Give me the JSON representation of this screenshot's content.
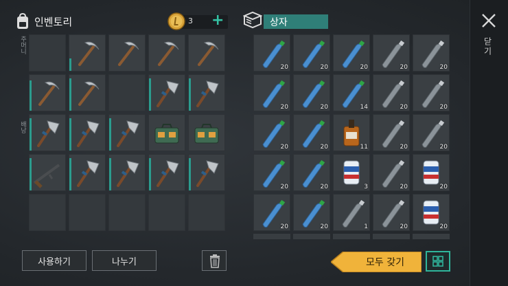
{
  "inventory": {
    "title": "인벤토리",
    "coins": "3",
    "pocket_label": "주머니",
    "bag_label": "배낭"
  },
  "box": {
    "title": "상자"
  },
  "close": {
    "label": "닫기"
  },
  "buttons": {
    "use": "사용하기",
    "split": "나누기",
    "take_all": "모두 갖기"
  },
  "colors": {
    "accent": "#2fb59b",
    "durability": "#2b9c8e",
    "take_all": "#f0b33a",
    "header_bar": "#2f7f78"
  },
  "inventory_slots": [
    {
      "item": "empty"
    },
    {
      "item": "pickaxe-icon",
      "durability": 0.35
    },
    {
      "item": "pickaxe-icon"
    },
    {
      "item": "pickaxe-icon"
    },
    {
      "item": "pickaxe-icon"
    },
    {
      "item": "pickaxe-icon",
      "durability": 0.85
    },
    {
      "item": "pickaxe-icon",
      "durability": 0.9
    },
    {
      "item": "empty"
    },
    {
      "item": "hatchet-icon",
      "durability": 0.9
    },
    {
      "item": "hatchet-icon",
      "durability": 0.9
    },
    {
      "item": "hatchet-icon",
      "durability": 0.9
    },
    {
      "item": "hatchet-icon",
      "durability": 0.9
    },
    {
      "item": "hatchet-icon",
      "durability": 0.9
    },
    {
      "item": "toolbox-icon"
    },
    {
      "item": "toolbox-icon"
    },
    {
      "item": "rifle-icon",
      "durability": 0.9
    },
    {
      "item": "hatchet-icon",
      "durability": 0.9
    },
    {
      "item": "hatchet-icon",
      "durability": 0.9
    },
    {
      "item": "hatchet-icon",
      "durability": 0.9
    },
    {
      "item": "hatchet-icon",
      "durability": 0.9
    },
    {
      "item": "empty"
    },
    {
      "item": "empty"
    },
    {
      "item": "empty"
    },
    {
      "item": "empty"
    },
    {
      "item": "empty"
    }
  ],
  "box_slots": [
    {
      "item": "water-bottle-icon",
      "qty": "20"
    },
    {
      "item": "water-bottle-icon",
      "qty": "20"
    },
    {
      "item": "water-bottle-icon",
      "qty": "20"
    },
    {
      "item": "empty-bottle-icon",
      "qty": "20"
    },
    {
      "item": "empty-bottle-icon",
      "qty": "20"
    },
    {
      "item": "water-bottle-icon",
      "qty": "20"
    },
    {
      "item": "water-bottle-icon",
      "qty": "20"
    },
    {
      "item": "water-bottle-icon",
      "qty": "14"
    },
    {
      "item": "empty-bottle-icon",
      "qty": "20"
    },
    {
      "item": "empty-bottle-icon",
      "qty": "20"
    },
    {
      "item": "water-bottle-icon",
      "qty": "20"
    },
    {
      "item": "water-bottle-icon",
      "qty": "20"
    },
    {
      "item": "whiskey-icon",
      "qty": "11"
    },
    {
      "item": "empty-bottle-icon",
      "qty": "20"
    },
    {
      "item": "empty-bottle-icon",
      "qty": "20"
    },
    {
      "item": "water-bottle-icon",
      "qty": "20"
    },
    {
      "item": "water-bottle-icon",
      "qty": "20"
    },
    {
      "item": "beer-can-icon",
      "qty": "3"
    },
    {
      "item": "empty-bottle-icon",
      "qty": "20"
    },
    {
      "item": "beer-can-icon",
      "qty": "20"
    },
    {
      "item": "water-bottle-icon",
      "qty": "20"
    },
    {
      "item": "water-bottle-icon",
      "qty": "20"
    },
    {
      "item": "empty-bottle-icon",
      "qty": "1"
    },
    {
      "item": "empty-bottle-icon",
      "qty": "20"
    },
    {
      "item": "beer-can-icon",
      "qty": "20"
    }
  ]
}
